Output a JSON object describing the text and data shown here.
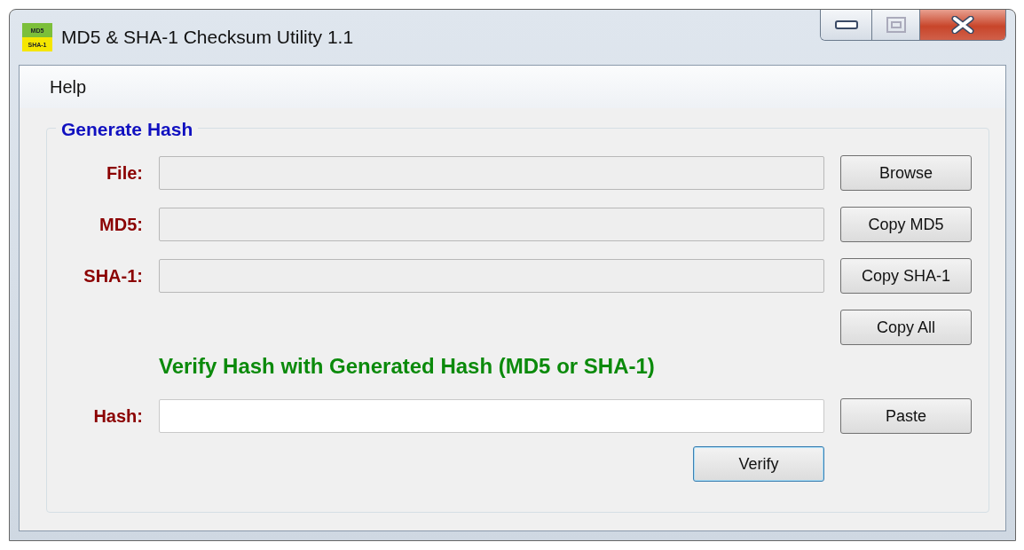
{
  "window": {
    "title": "MD5 & SHA-1 Checksum Utility 1.1",
    "icon_text": [
      "MD5",
      "SHA-1"
    ]
  },
  "menu": [
    "Help"
  ],
  "group": {
    "title": "Generate Hash",
    "rows": [
      {
        "label": "File:",
        "readonly": true,
        "button": "Browse"
      },
      {
        "label": "MD5:",
        "readonly": true,
        "button": "Copy MD5"
      },
      {
        "label": "SHA-1:",
        "readonly": true,
        "button": "Copy SHA-1"
      }
    ],
    "copy_all_button": "Copy All",
    "verify_heading": "Verify Hash with Generated Hash (MD5 or SHA-1)",
    "hash_row": {
      "label": "Hash:",
      "readonly": false,
      "button": "Paste"
    },
    "verify_button": "Verify"
  }
}
